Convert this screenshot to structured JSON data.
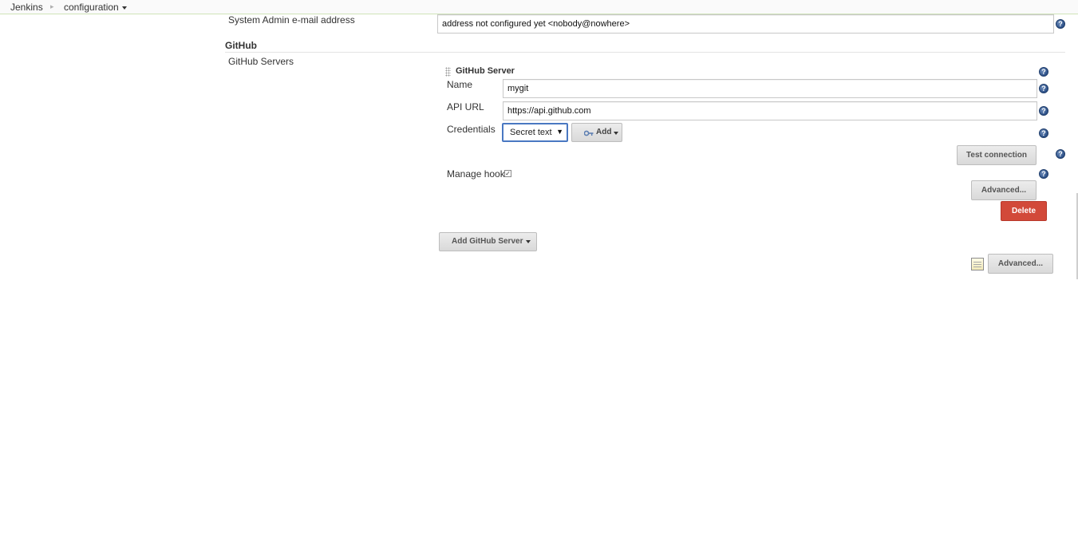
{
  "breadcrumb": {
    "items": [
      "Jenkins",
      "configuration"
    ]
  },
  "admin_email": {
    "label": "System Admin e-mail address",
    "value": "address not configured yet <nobody@nowhere>"
  },
  "github": {
    "section_title": "GitHub",
    "servers_label": "GitHub Servers",
    "server": {
      "title": "GitHub Server",
      "name_label": "Name",
      "name_value": "mygit",
      "api_url_label": "API URL",
      "api_url_value": "https://api.github.com",
      "credentials_label": "Credentials",
      "credentials_selected": "Secret text",
      "add_label": "Add",
      "test_connection_label": "Test connection",
      "manage_hooks_label": "Manage hooks",
      "manage_hooks_checked": true,
      "advanced_label": "Advanced...",
      "delete_label": "Delete"
    },
    "add_server_label": "Add GitHub Server",
    "section_advanced_label": "Advanced..."
  },
  "help_icon_glyph": "?",
  "colors": {
    "delete_button": "#d24939",
    "help_icon": "#2e5289",
    "select_focus": "#4a78c2"
  }
}
